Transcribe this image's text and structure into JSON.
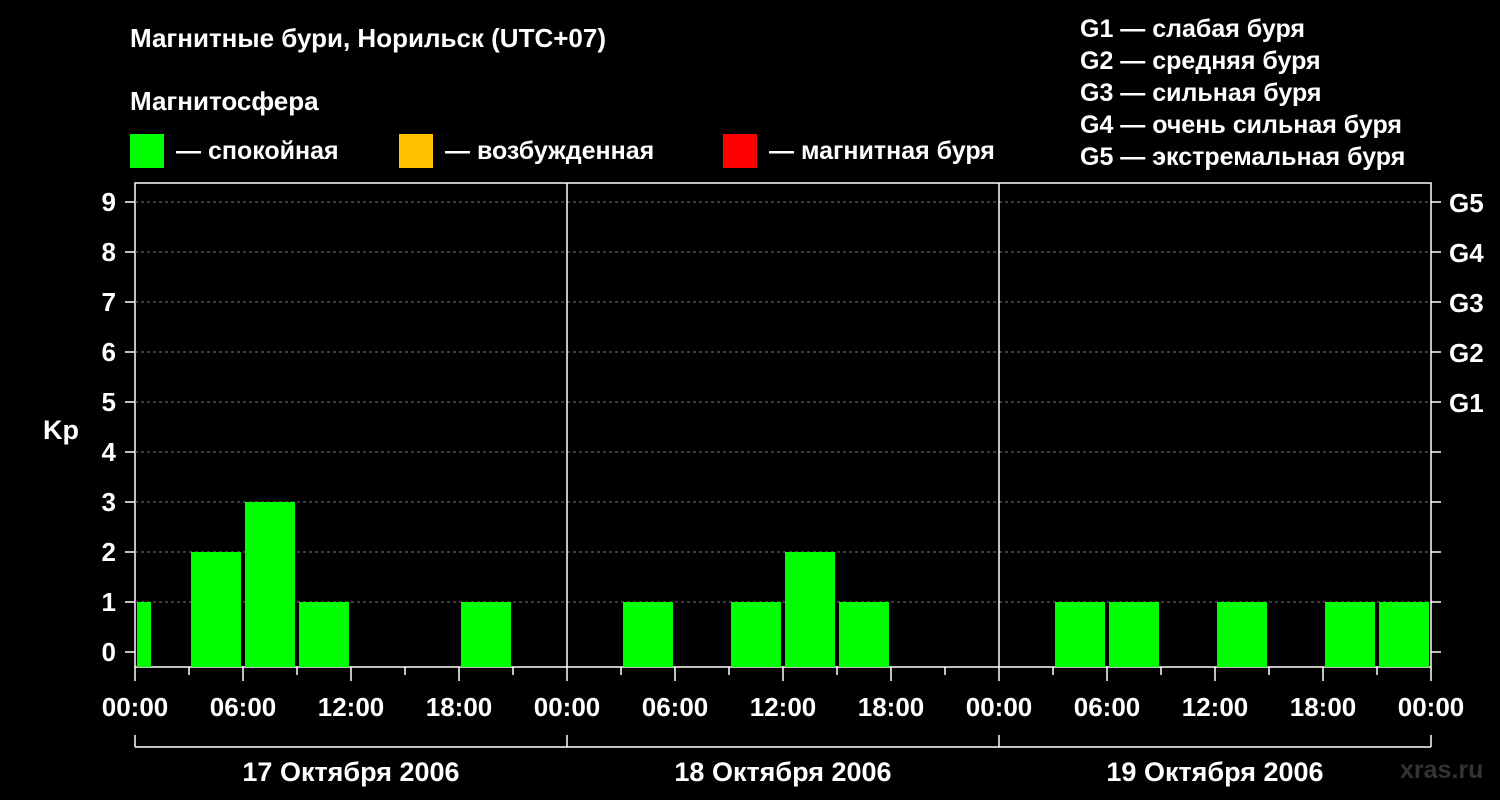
{
  "title": "Магнитные бури, Норильск (UTC+07)",
  "subtitle": "Магнитосфера",
  "legend": [
    {
      "label": "— спокойная",
      "color": "#00ff00"
    },
    {
      "label": "— возбужденная",
      "color": "#ffc000"
    },
    {
      "label": "— магнитная буря",
      "color": "#ff0000"
    }
  ],
  "g_legend": [
    "G1 — слабая буря",
    "G2 — средняя буря",
    "G3 — сильная буря",
    "G4 — очень сильная буря",
    "G5 — экстремальная буря"
  ],
  "watermark": "xras.ru",
  "chart_data": {
    "type": "bar",
    "ylabel": "Kp",
    "ylim": [
      0,
      9
    ],
    "yticks": [
      "0",
      "1",
      "2",
      "3",
      "4",
      "5",
      "6",
      "7",
      "8",
      "9"
    ],
    "right_ticks": [
      {
        "y": 5,
        "label": "G1"
      },
      {
        "y": 6,
        "label": "G2"
      },
      {
        "y": 7,
        "label": "G3"
      },
      {
        "y": 8,
        "label": "G4"
      },
      {
        "y": 9,
        "label": "G5"
      }
    ],
    "xtick_labels": [
      "00:00",
      "06:00",
      "12:00",
      "18:00",
      "00:00",
      "06:00",
      "12:00",
      "18:00",
      "00:00",
      "06:00",
      "12:00",
      "18:00",
      "00:00"
    ],
    "days": [
      "17 Октября 2006",
      "18 Октября 2006",
      "19 Октября 2006"
    ],
    "interval_hours": 3,
    "values": [
      [
        1,
        2,
        3,
        1,
        0,
        0,
        1,
        0
      ],
      [
        0,
        1,
        0,
        1,
        2,
        1,
        0,
        0
      ],
      [
        0,
        1,
        1,
        0,
        1,
        0,
        1,
        1
      ]
    ],
    "grid": true,
    "legend_position": "top"
  }
}
